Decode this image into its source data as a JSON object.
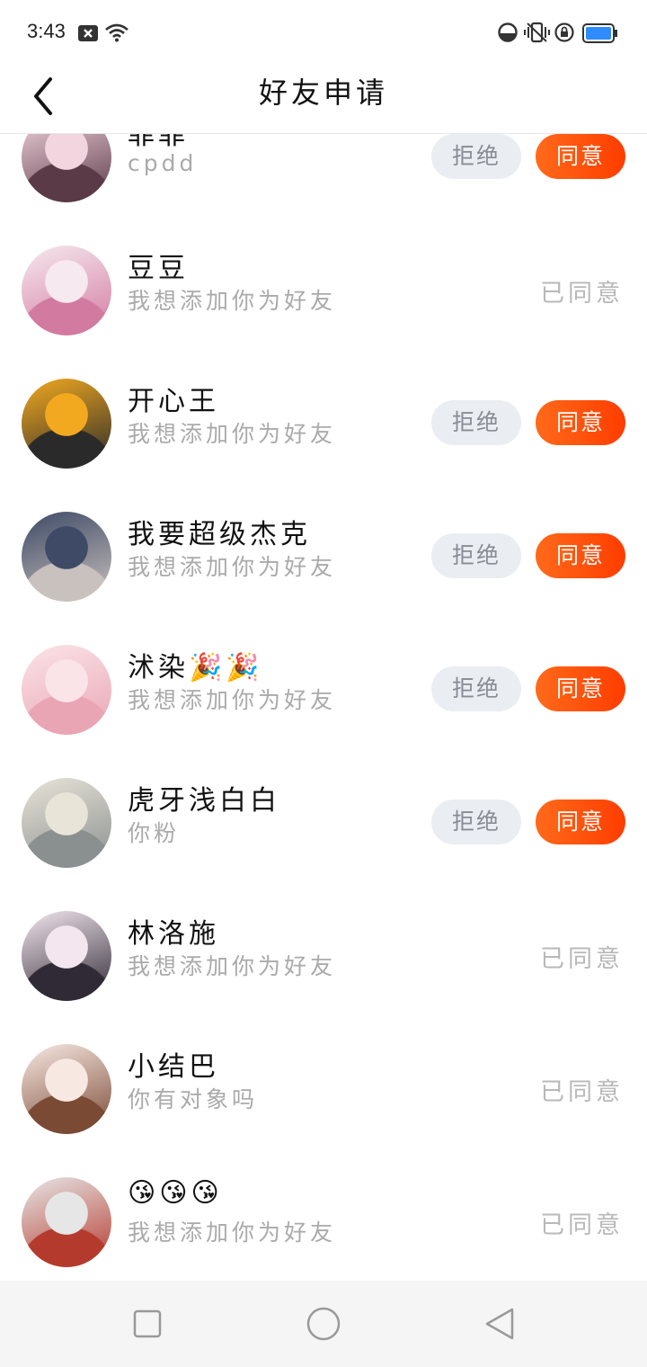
{
  "status_bar": {
    "time": "3:43"
  },
  "header": {
    "title": "好友申请"
  },
  "buttons": {
    "reject": "拒绝",
    "agree": "同意"
  },
  "requests": [
    {
      "name": "菲菲",
      "message": "cpdd",
      "state": "pending",
      "status_label": "",
      "avatar_colors": [
        "#f3d5e0",
        "#5a3a46"
      ]
    },
    {
      "name": "豆豆",
      "message": "我想添加你为好友",
      "state": "accepted",
      "status_label": "已同意",
      "avatar_colors": [
        "#f6e9ef",
        "#d27aa0"
      ]
    },
    {
      "name": "开心王",
      "message": "我想添加你为好友",
      "state": "pending",
      "status_label": "",
      "avatar_colors": [
        "#f2a91f",
        "#2a2a2a"
      ]
    },
    {
      "name": "我要超级杰克",
      "message": "我想添加你为好友",
      "state": "pending",
      "status_label": "",
      "avatar_colors": [
        "#3e4a66",
        "#c9c1bd"
      ]
    },
    {
      "name": "沭染🎉🎉",
      "message": "我想添加你为好友",
      "state": "pending",
      "status_label": "",
      "avatar_colors": [
        "#fbe4e8",
        "#e9a5b4"
      ]
    },
    {
      "name": "虎牙浅白白",
      "message": "你粉",
      "state": "pending",
      "status_label": "",
      "avatar_colors": [
        "#e8e4d8",
        "#8a8f8f"
      ]
    },
    {
      "name": "林洛施",
      "message": "我想添加你为好友",
      "state": "accepted",
      "status_label": "已同意",
      "avatar_colors": [
        "#f3e6ee",
        "#2f2a35"
      ]
    },
    {
      "name": "小结巴",
      "message": "你有对象吗",
      "state": "accepted",
      "status_label": "已同意",
      "avatar_colors": [
        "#f7e8e2",
        "#7a4a35"
      ]
    },
    {
      "name": "😘😘😘",
      "message": "我想添加你为好友",
      "state": "accepted",
      "status_label": "已同意",
      "avatar_colors": [
        "#e6e6e6",
        "#b53a2e"
      ]
    }
  ],
  "nav_bar": {
    "icons": [
      "recents-square-icon",
      "home-circle-icon",
      "back-triangle-icon"
    ]
  }
}
